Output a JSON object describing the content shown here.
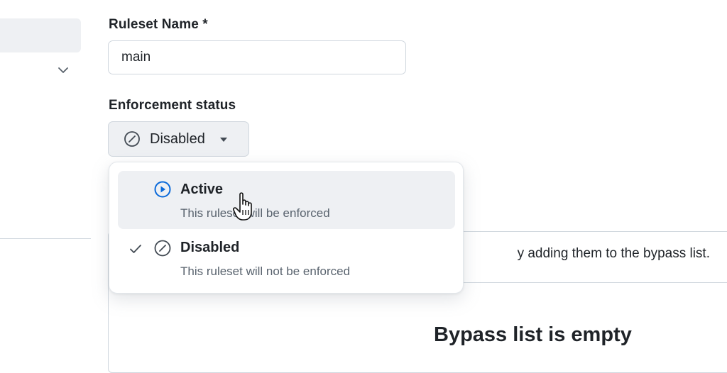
{
  "form": {
    "name_label": "Ruleset Name *",
    "name_value": "main",
    "enforcement_label": "Enforcement status",
    "enforcement_selected": "Disabled"
  },
  "menu": {
    "items": [
      {
        "title": "Active",
        "description": "This ruleset will be enforced",
        "icon": "play-circle-icon",
        "selected": false,
        "hovered": true
      },
      {
        "title": "Disabled",
        "description": "This ruleset will not be enforced",
        "icon": "slash-circle-icon",
        "selected": true,
        "hovered": false
      }
    ]
  },
  "bypass": {
    "description": "y adding them to the bypass list.",
    "empty_title": "Bypass list is empty"
  },
  "colors": {
    "accent": "#0969da",
    "hover_bg": "#eef0f3",
    "border": "#d0d7de",
    "muted_text": "#59636e"
  }
}
